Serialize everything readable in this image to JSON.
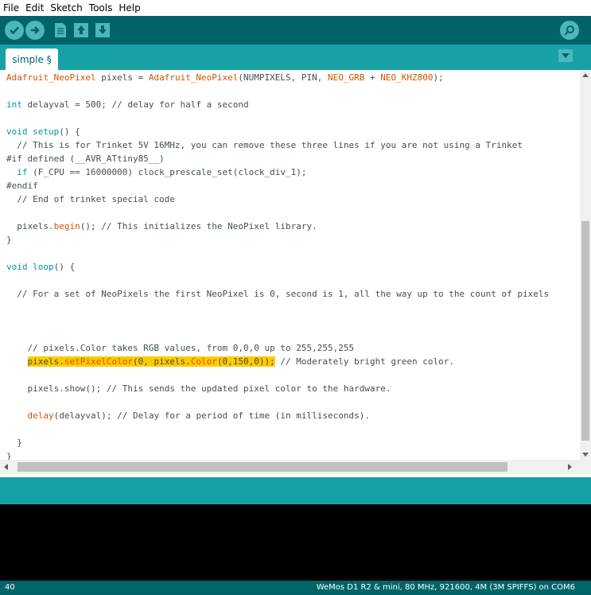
{
  "menu": [
    "File",
    "Edit",
    "Sketch",
    "Tools",
    "Help"
  ],
  "toolbar": {
    "verify": "verify-button",
    "upload": "upload-button",
    "new": "new-button",
    "open": "open-button",
    "save": "save-button",
    "serial_monitor": "serial-monitor-button"
  },
  "tab": {
    "label": "simple §"
  },
  "code_lines": [
    [
      {
        "t": "Adafruit_NeoPixel",
        "c": "fn"
      },
      {
        "t": " pixels = "
      },
      {
        "t": "Adafruit_NeoPixel",
        "c": "fn"
      },
      {
        "t": "(NUMPIXELS, PIN, "
      },
      {
        "t": "NEO_GRB",
        "c": "fn"
      },
      {
        "t": " + "
      },
      {
        "t": "NEO_KHZ800",
        "c": "fn"
      },
      {
        "t": ");"
      }
    ],
    [],
    [
      {
        "t": "int",
        "c": "kw"
      },
      {
        "t": " delayval = 500; "
      },
      {
        "t": "// delay for half a second",
        "c": "cm"
      }
    ],
    [],
    [
      {
        "t": "void",
        "c": "kw"
      },
      {
        "t": " "
      },
      {
        "t": "setup",
        "c": "kw"
      },
      {
        "t": "() {"
      }
    ],
    [
      {
        "t": "  // This is for Trinket 5V 16MHz, you can remove these three lines if you are not using a Trinket",
        "c": "cm"
      }
    ],
    [
      {
        "t": "#if defined (__AVR_ATtiny85__)"
      }
    ],
    [
      {
        "t": "  "
      },
      {
        "t": "if",
        "c": "kw"
      },
      {
        "t": " (F_CPU == 16000000) clock_prescale_set(clock_div_1);"
      }
    ],
    [
      {
        "t": "#endif"
      }
    ],
    [
      {
        "t": "  // End of trinket special code",
        "c": "cm"
      }
    ],
    [],
    [
      {
        "t": "  pixels."
      },
      {
        "t": "begin",
        "c": "fn"
      },
      {
        "t": "(); "
      },
      {
        "t": "// This initializes the NeoPixel library.",
        "c": "cm"
      }
    ],
    [
      {
        "t": "}"
      }
    ],
    [],
    [
      {
        "t": "void",
        "c": "kw"
      },
      {
        "t": " "
      },
      {
        "t": "loop",
        "c": "kw"
      },
      {
        "t": "() {"
      }
    ],
    [],
    [
      {
        "t": "  // For a set of NeoPixels the first NeoPixel is 0, second is 1, all the way up to the count of pixels",
        "c": "cm"
      }
    ],
    [],
    [],
    [],
    [
      {
        "t": "    // pixels.Color takes RGB values, from 0,0,0 up to 255,255,255",
        "c": "cm"
      }
    ],
    [
      {
        "t": "    "
      },
      {
        "t": "pixels.",
        "h": true
      },
      {
        "t": "setPixelColor",
        "c": "fn",
        "h": true
      },
      {
        "t": "(0, pixels.",
        "h": true
      },
      {
        "t": "Color",
        "c": "fn",
        "h": true
      },
      {
        "t": "(0,150,0));",
        "h": true
      },
      {
        "t": " "
      },
      {
        "t": "// Moderately bright green color.",
        "c": "cm"
      }
    ],
    [],
    [
      {
        "t": "    pixels.show(); "
      },
      {
        "t": "// This sends the updated pixel color to the hardware.",
        "c": "cm"
      }
    ],
    [],
    [
      {
        "t": "    "
      },
      {
        "t": "delay",
        "c": "fn"
      },
      {
        "t": "(delayval); "
      },
      {
        "t": "// Delay for a period of time (in milliseconds).",
        "c": "cm"
      }
    ],
    [],
    [
      {
        "t": "  }"
      }
    ],
    [
      {
        "t": "}"
      }
    ]
  ],
  "status": {
    "line": "40",
    "board": "WeMos D1 R2 & mini, 80 MHz, 921600, 4M (3M SPIFFS) on COM6"
  },
  "colors": {
    "toolbar": "#006468",
    "tabbar": "#17a1a5",
    "keyword": "#00979c",
    "function": "#d35400",
    "highlight": "#ffcc00"
  }
}
